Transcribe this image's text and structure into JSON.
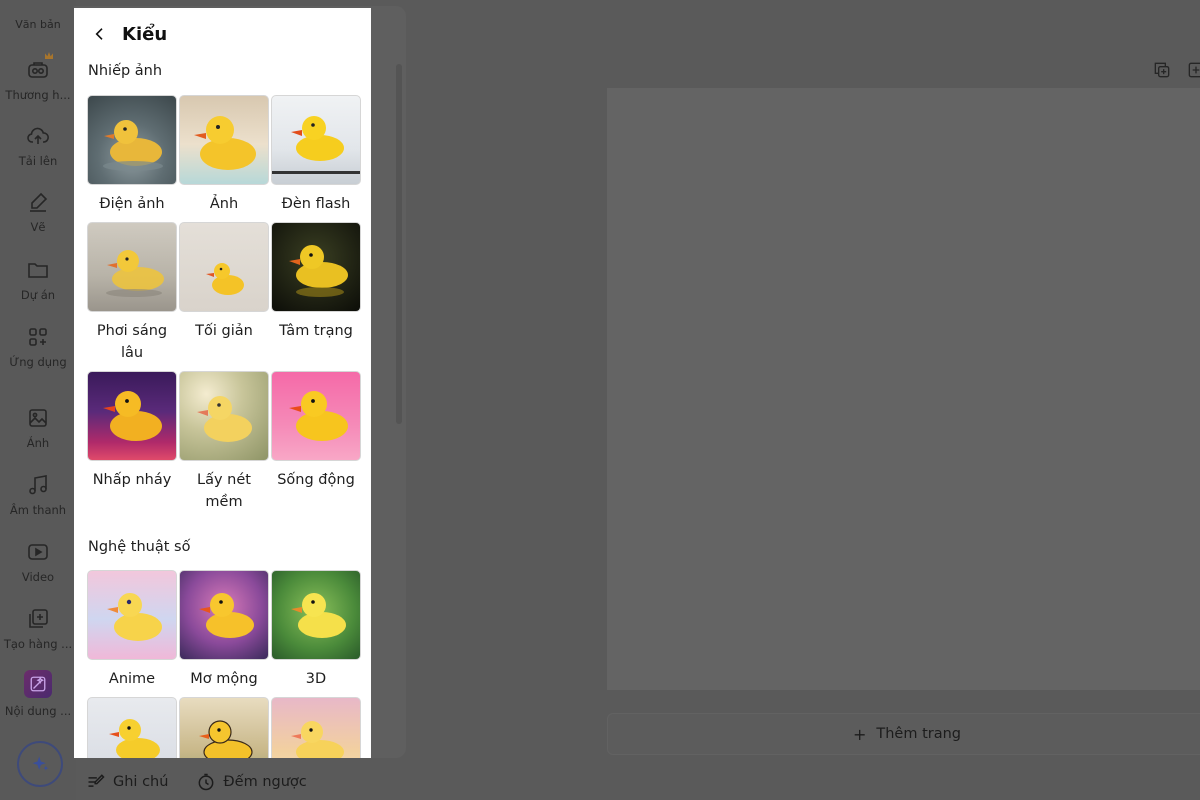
{
  "rail": {
    "top_label": "Văn bản",
    "items": [
      {
        "label": "Thương h...",
        "icon": "brand-kit-icon"
      },
      {
        "label": "Tải lên",
        "icon": "cloud-upload-icon"
      },
      {
        "label": "Vẽ",
        "icon": "pen-icon"
      },
      {
        "label": "Dự án",
        "icon": "folder-icon"
      },
      {
        "label": "Ứng dụng",
        "icon": "apps-icon"
      },
      {
        "label": "Ảnh",
        "icon": "image-icon"
      },
      {
        "label": "Âm thanh",
        "icon": "music-icon"
      },
      {
        "label": "Video",
        "icon": "video-icon"
      },
      {
        "label": "Tạo hàng ...",
        "icon": "bulk-create-icon"
      },
      {
        "label": "Nội dung ...",
        "icon": "magic-media-icon"
      }
    ]
  },
  "panel": {
    "title": "Kiểu",
    "sections": [
      {
        "title": "Nhiếp ảnh",
        "tiles": [
          {
            "label": "Điện ảnh"
          },
          {
            "label": "Ảnh"
          },
          {
            "label": "Đèn flash"
          },
          {
            "label": "Phơi sáng lâu"
          },
          {
            "label": "Tối giản"
          },
          {
            "label": "Tâm trạng"
          },
          {
            "label": "Nhấp nháy"
          },
          {
            "label": "Lấy nét mềm"
          },
          {
            "label": "Sống động"
          }
        ]
      },
      {
        "title": "Nghệ thuật số",
        "tiles": [
          {
            "label": "Anime"
          },
          {
            "label": "Mơ mộng"
          },
          {
            "label": "3D"
          }
        ]
      }
    ]
  },
  "workspace": {
    "add_page_label": "Thêm trang"
  },
  "footer": {
    "notes_label": "Ghi chú",
    "timer_label": "Đếm ngược"
  },
  "colors": {
    "accent": "#7d2ae8",
    "duck_yellow": "#f5c518"
  }
}
